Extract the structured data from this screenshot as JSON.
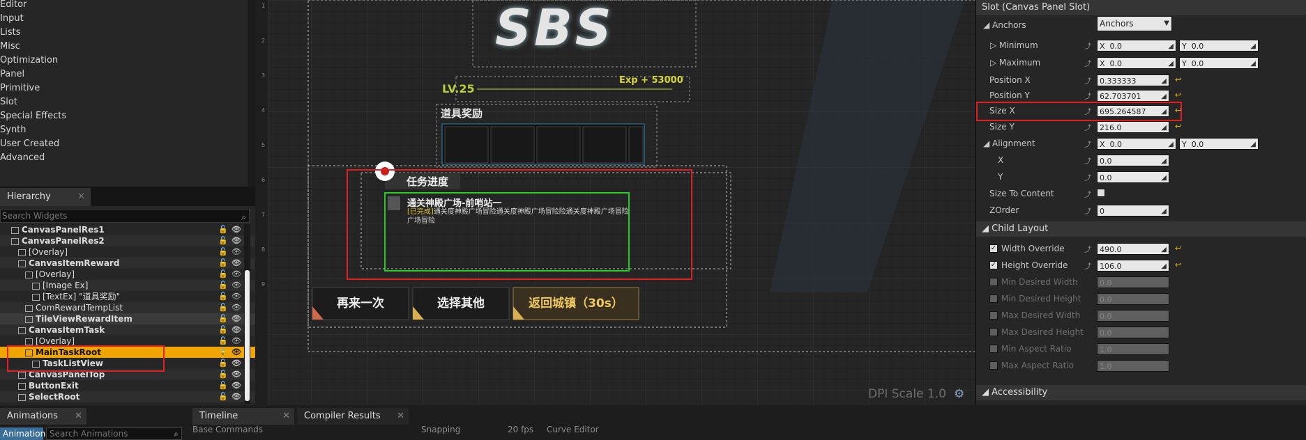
{
  "palette": {
    "items": [
      "Editor",
      "Input",
      "Lists",
      "Misc",
      "Optimization",
      "Panel",
      "Primitive",
      "Slot",
      "Special Effects",
      "Synth",
      "User Created",
      "Advanced"
    ]
  },
  "hierarchy": {
    "tab_label": "Hierarchy",
    "search_placeholder": "Search Widgets",
    "rows": [
      {
        "label": "CanvasPanelRes1",
        "bold": true
      },
      {
        "label": "CanvasPanelRes2",
        "bold": true
      },
      {
        "label": "[Overlay]",
        "bold": false
      },
      {
        "label": "CanvasItemReward",
        "bold": true
      },
      {
        "label": "[Overlay]",
        "bold": false
      },
      {
        "label": "[Image Ex]",
        "bold": false
      },
      {
        "label": "[TextEx] \"道具奖励\"",
        "bold": false
      },
      {
        "label": "ComRewardTempList",
        "bold": false
      },
      {
        "label": "TileViewRewardItem",
        "bold": true
      },
      {
        "label": "CanvasItemTask",
        "bold": true
      },
      {
        "label": "[Overlay]",
        "bold": false
      },
      {
        "label": "MainTaskRoot",
        "bold": true
      },
      {
        "label": "TaskListView",
        "bold": true
      },
      {
        "label": "CanvasPanelTop",
        "bold": true
      },
      {
        "label": "ButtonExit",
        "bold": true
      },
      {
        "label": "SelectRoot",
        "bold": true
      }
    ]
  },
  "designer": {
    "game": {
      "logo": "SBS",
      "level": "LV.25",
      "exp": "Exp + 53000",
      "reward_title": "道具奖励",
      "task_title": "任务进度",
      "task_name": "通关神殿广场-前哨站一",
      "task_done_tag": "[已完成]",
      "task_desc": "通关度神殿广场冒险通关度神殿广场冒险险通关度神殿广场冒险广场冒险",
      "buttons": [
        "再来一次",
        "选择其他",
        "返回城镇（30s）"
      ]
    },
    "dpi_label": "DPI Scale 1.0",
    "ruler_ticks": [
      "1",
      "2",
      "3",
      "4",
      "5",
      "6",
      "7",
      "8",
      "9"
    ]
  },
  "details": {
    "slot_header": "Slot (Canvas Panel Slot)",
    "anchors_label": "Anchors",
    "anchors_value": "Anchors",
    "minimum": {
      "label": "Minimum",
      "x": "0.0",
      "y": "0.0"
    },
    "maximum": {
      "label": "Maximum",
      "x": "0.0",
      "y": "0.0"
    },
    "position_x": {
      "label": "Position X",
      "value": "0.333333"
    },
    "position_y": {
      "label": "Position Y",
      "value": "62.703701"
    },
    "size_x": {
      "label": "Size X",
      "value": "695.264587"
    },
    "size_y": {
      "label": "Size Y",
      "value": "216.0"
    },
    "alignment": {
      "label": "Alignment",
      "x": "0.0",
      "y": "0.0",
      "x_label": "X",
      "y_label": "Y",
      "x_value": "0.0",
      "y_value": "0.0"
    },
    "size_to_content": "Size To Content",
    "zorder": {
      "label": "ZOrder",
      "value": "0"
    },
    "child_layout_header": "Child Layout",
    "width_override": {
      "label": "Width Override",
      "value": "490.0"
    },
    "height_override": {
      "label": "Height Override",
      "value": "106.0"
    },
    "disabled_rows": [
      {
        "label": "Min Desired Width",
        "value": "0.0"
      },
      {
        "label": "Min Desired Height",
        "value": "0.0"
      },
      {
        "label": "Max Desired Width",
        "value": "0.0"
      },
      {
        "label": "Max Desired Height",
        "value": "0.0"
      },
      {
        "label": "Min Aspect Ratio",
        "value": "1.0"
      },
      {
        "label": "Max Aspect Ratio",
        "value": "1.0"
      }
    ],
    "accessibility_header": "Accessibility"
  },
  "bottom": {
    "animations_tab": "Animations",
    "timeline_tab": "Timeline",
    "compiler_tab": "Compiler Results",
    "animation_button": "Animation",
    "search_animations": "Search Animations",
    "base_commands": "Base Commands",
    "snapping": "Snapping",
    "fps": "20 fps",
    "curve_editor": "Curve Editor"
  },
  "colors": {
    "selection": "#f0a500",
    "highlight_red": "#e02020",
    "selected_widget_green": "#22cc22",
    "reset_yellow": "#e2c300"
  }
}
